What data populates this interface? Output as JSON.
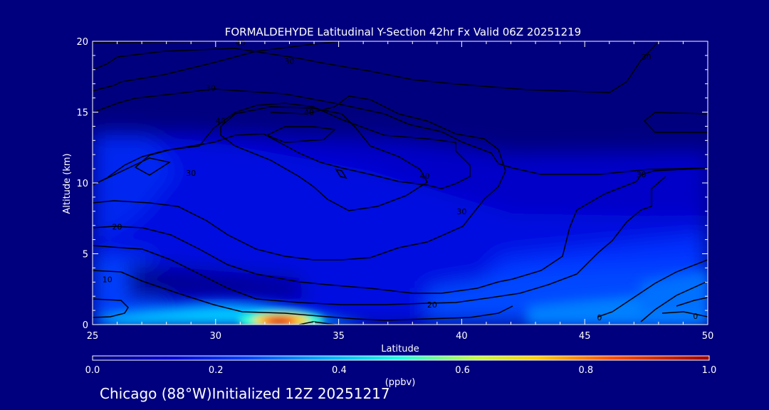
{
  "chart_data": {
    "type": "heatmap",
    "title": "FORMALDEHYDE Latitudinal Y-Section 42hr  Fx Valid 06Z 20251219",
    "xlabel": "Latitude",
    "ylabel": "Altitude (km)",
    "xlim": [
      25,
      50
    ],
    "ylim": [
      0,
      20
    ],
    "x_ticks": [
      "25",
      "30",
      "35",
      "40",
      "45",
      "50"
    ],
    "y_ticks": [
      "0",
      "5",
      "10",
      "15",
      "20"
    ],
    "colorbar": {
      "label": "(ppbv)",
      "range": [
        0.0,
        1.0
      ],
      "ticks": [
        "0.0",
        "0.2",
        "0.4",
        "0.6",
        "0.8",
        "1.0"
      ]
    },
    "contour_labels": [
      {
        "text": "40",
        "x": 31.0,
        "y": 19.9
      },
      {
        "text": "30",
        "x": 33.0,
        "y": 18.6
      },
      {
        "text": "30",
        "x": 47.5,
        "y": 18.9
      },
      {
        "text": "30",
        "x": 29.8,
        "y": 16.7
      },
      {
        "text": "40",
        "x": 33.8,
        "y": 15.0
      },
      {
        "text": "40",
        "x": 30.2,
        "y": 14.4
      },
      {
        "text": "30",
        "x": 29.0,
        "y": 10.7
      },
      {
        "text": "40",
        "x": 38.5,
        "y": 10.5
      },
      {
        "text": "30",
        "x": 47.3,
        "y": 10.6
      },
      {
        "text": "30",
        "x": 40.0,
        "y": 8.0
      },
      {
        "text": "20",
        "x": 26.0,
        "y": 6.9
      },
      {
        "text": "10",
        "x": 25.6,
        "y": 3.2
      },
      {
        "text": "20",
        "x": 38.8,
        "y": 1.4
      },
      {
        "text": "0",
        "x": 45.6,
        "y": 0.5
      },
      {
        "text": "0",
        "x": 49.5,
        "y": 0.6
      }
    ],
    "grid": false
  },
  "colors": {
    "background": "#00007f",
    "plot_background": "#00007f",
    "axis": "#ffffff",
    "contour": "#000000"
  },
  "footer": "Chicago (88°W)Initialized 12Z 20251217"
}
